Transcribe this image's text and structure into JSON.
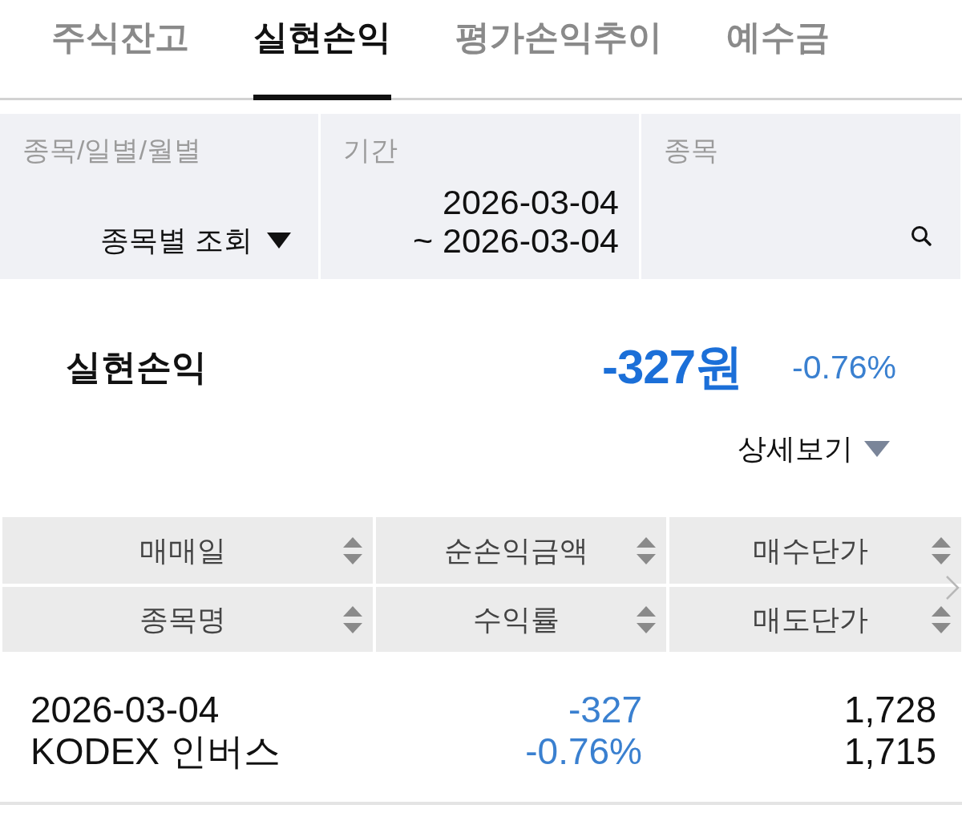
{
  "tabs": [
    {
      "label": "주식잔고",
      "selected": false
    },
    {
      "label": "실현손익",
      "selected": true
    },
    {
      "label": "평가손익추이",
      "selected": false
    },
    {
      "label": "예수금",
      "selected": false
    }
  ],
  "filters": [
    {
      "kind": "dropdown",
      "label": "종목/일별/월별",
      "value": "종목별 조회"
    },
    {
      "kind": "date_range",
      "label": "기간",
      "start": "2026-03-04",
      "end": "~ 2026-03-04"
    },
    {
      "kind": "search",
      "label": "종목"
    }
  ],
  "summary": {
    "label": "실현손익",
    "amount": "-327원",
    "rate": "-0.76%",
    "loss": true
  },
  "detail_toggle": {
    "label": "상세보기",
    "expanded": false
  },
  "table": {
    "header_rows": [
      [
        "매매일",
        "순손익금액",
        "매수단가"
      ],
      [
        "종목명",
        "수익률",
        "매도단가"
      ]
    ],
    "rows": [
      {
        "loss": true,
        "cells": [
          [
            "2026-03-04",
            "KODEX 인버스"
          ],
          [
            "-327",
            "-0.76%"
          ],
          [
            "1,728",
            "1,715"
          ]
        ]
      }
    ]
  }
}
